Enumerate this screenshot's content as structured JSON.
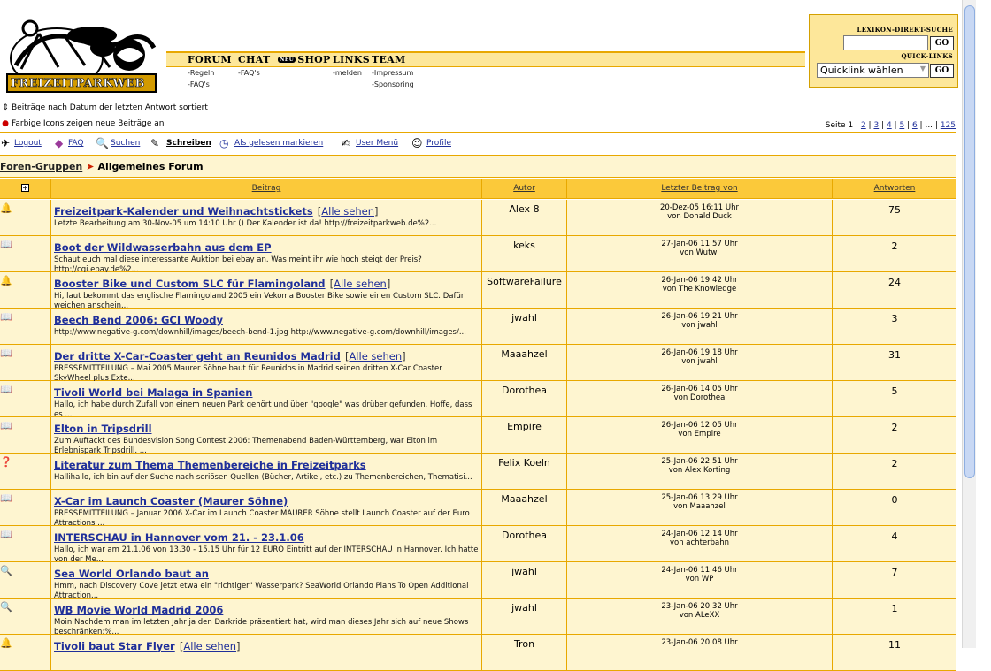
{
  "logo": {
    "text": "FREIZEITPARKWEB"
  },
  "nav": {
    "forum": "FORUM",
    "chat": "CHAT",
    "shop": "SHOP",
    "shop_badge": "NEU",
    "links": "LINKS",
    "team": "TEAM",
    "sub_regeln": "-Regeln",
    "sub_faqs_forum": "-FAQ's",
    "sub_faqs_chat": "-FAQ's",
    "sub_melden": "-melden",
    "sub_impressum": "-Impressum",
    "sub_sponsoring": "-Sponsoring"
  },
  "search": {
    "lexikon_title": "LEXIKON-DIREKT-SUCHE",
    "lexikon_value": "",
    "go_label": "GO",
    "quicklinks_title": "QUICK-LINKS",
    "quicklinks_selected": "Quicklink wählen"
  },
  "info": {
    "sort_note": "Beiträge nach Datum der letzten Antwort sortiert",
    "color_note": "Farbige Icons zeigen neue Beiträge an"
  },
  "pagination": {
    "prefix": "Seite 1 |",
    "pages": [
      "2",
      "3",
      "4",
      "5",
      "6"
    ],
    "ellipsis": "...",
    "last": "125"
  },
  "toolbar": {
    "logout": "Logout",
    "faq": "FAQ",
    "suchen": "Suchen",
    "schreiben": "Schreiben",
    "gelesen": "Als gelesen markieren",
    "usermenu": "User Menü",
    "profile": "Profile"
  },
  "breadcrumb": {
    "parent": "Foren-Gruppen",
    "current": "Allgemeines Forum"
  },
  "table": {
    "headers": {
      "expand": "+",
      "beitrag": "Beitrag",
      "autor": "Autor",
      "letzter": "Letzter Beitrag von",
      "antworten": "Antworten"
    },
    "rows": [
      {
        "icon": "🔔",
        "title": "Freizeitpark-Kalender und Weihnachtstickets",
        "all": "Alle sehen",
        "excerpt": "Letzte Bearbeitung am 30-Nov-05 um 14:10 Uhr () Der Kalender ist da! http://freizeitparkweb.de%2...",
        "author": "Alex 8",
        "last_date": "20-Dez-05 16:11 Uhr",
        "last_by": "von Donald Duck",
        "replies": "75"
      },
      {
        "icon": "📖",
        "title": "Boot der Wildwasserbahn aus dem EP",
        "all": "",
        "excerpt": "Schaut euch mal diese interessante Auktion bei ebay an. Was meint ihr wie hoch steigt der Preis? http://cgi.ebay.de%2...",
        "author": "keks",
        "last_date": "27-Jan-06 11:57 Uhr",
        "last_by": "von Wutwi",
        "replies": "2"
      },
      {
        "icon": "🔔",
        "title": "Booster Bike und Custom SLC für Flamingoland",
        "all": "Alle sehen",
        "excerpt": "Hi, laut bekommt das englische Flamingoland 2005 ein Vekoma Booster Bike sowie einen Custom SLC. Dafür weichen anschein...",
        "author": "SoftwareFailure",
        "last_date": "26-Jan-06 19:42 Uhr",
        "last_by": "von The Knowledge",
        "replies": "24"
      },
      {
        "icon": "📖",
        "title": "Beech Bend 2006: GCI Woody",
        "all": "",
        "excerpt": "http://www.negative-g.com/downhill/images/beech-bend-1.jpg http://www.negative-g.com/downhill/images/...",
        "author": "jwahl",
        "last_date": "26-Jan-06 19:21 Uhr",
        "last_by": "von jwahl",
        "replies": "3"
      },
      {
        "icon": "📖",
        "title": "Der dritte X-Car-Coaster geht an Reunidos Madrid",
        "all": "Alle sehen",
        "excerpt": "PRESSEMITTEILUNG – Mai 2005 Maurer Söhne baut für Reunidos in Madrid seinen dritten X-Car Coaster SkyWheel plus Exte...",
        "author": "Maaahzel",
        "last_date": "26-Jan-06 19:18 Uhr",
        "last_by": "von jwahl",
        "replies": "31"
      },
      {
        "icon": "📖",
        "title": "Tivoli World bei Malaga in Spanien",
        "all": "",
        "excerpt": "Hallo, ich habe durch Zufall von einem neuen Park gehört und über \"google\" was drüber gefunden. Hoffe, dass es ...",
        "author": "Dorothea",
        "last_date": "26-Jan-06 14:05 Uhr",
        "last_by": "von Dorothea",
        "replies": "5"
      },
      {
        "icon": "📖",
        "title": "Elton in Tripsdrill",
        "all": "",
        "excerpt": "Zum Auftackt des Bundesvision Song Contest 2006: Themenabend Baden-Württemberg, war Elton im Erlebnispark Tripsdrill. ...",
        "author": "Empire",
        "last_date": "26-Jan-06 12:05 Uhr",
        "last_by": "von Empire",
        "replies": "2"
      },
      {
        "icon": "❓",
        "title": "Literatur zum Thema Themenbereiche in Freizeitparks",
        "all": "",
        "excerpt": "Hallihallo, ich bin auf der Suche nach seriösen Quellen (Bücher, Artikel, etc.) zu Themenbereichen, Thematisi...",
        "author": "Felix Koeln",
        "last_date": "25-Jan-06 22:51 Uhr",
        "last_by": "von Alex Korting",
        "replies": "2"
      },
      {
        "icon": "📖",
        "title": "X-Car im Launch Coaster (Maurer Söhne)",
        "all": "",
        "excerpt": "PRESSEMITTEILUNG – Januar 2006 X-Car im Launch Coaster MAURER Söhne stellt Launch Coaster auf der Euro Attractions ...",
        "author": "Maaahzel",
        "last_date": "25-Jan-06 13:29 Uhr",
        "last_by": "von Maaahzel",
        "replies": "0"
      },
      {
        "icon": "📖",
        "title": "INTERSCHAU in Hannover vom 21. - 23.1.06",
        "all": "",
        "excerpt": "Hallo, ich war am 21.1.06 von 13.30 - 15.15 Uhr für 12 EURO Eintritt auf der INTERSCHAU in Hannover. Ich hatte von der Me...",
        "author": "Dorothea",
        "last_date": "24-Jan-06 12:14 Uhr",
        "last_by": "von achterbahn",
        "replies": "4"
      },
      {
        "icon": "🔍",
        "title": "Sea World Orlando baut an",
        "all": "",
        "excerpt": "Hmm, nach Discovery Cove jetzt etwa ein \"richtiger\" Wasserpark? SeaWorld Orlando Plans To Open Additional Attraction...",
        "author": "jwahl",
        "last_date": "24-Jan-06 11:46 Uhr",
        "last_by": "von WP",
        "replies": "7"
      },
      {
        "icon": "🔍",
        "title": "WB Movie World Madrid 2006",
        "all": "",
        "excerpt": "Moin Nachdem man im letzten Jahr ja den Darkride präsentiert hat, wird man dieses Jahr sich auf neue Shows beschränken:%...",
        "author": "jwahl",
        "last_date": "23-Jan-06 20:32 Uhr",
        "last_by": "von ALeXX",
        "replies": "1"
      },
      {
        "icon": "🔔",
        "title": "Tivoli baut Star Flyer",
        "all": "Alle sehen",
        "excerpt": "",
        "author": "Tron",
        "last_date": "23-Jan-06 20:08 Uhr",
        "last_by": "",
        "replies": "11"
      }
    ]
  },
  "colors": {
    "header_yellow": "#fbc93a",
    "row_bg": "#fef5d0",
    "border": "#e8a800",
    "link": "#1f2f9a"
  }
}
